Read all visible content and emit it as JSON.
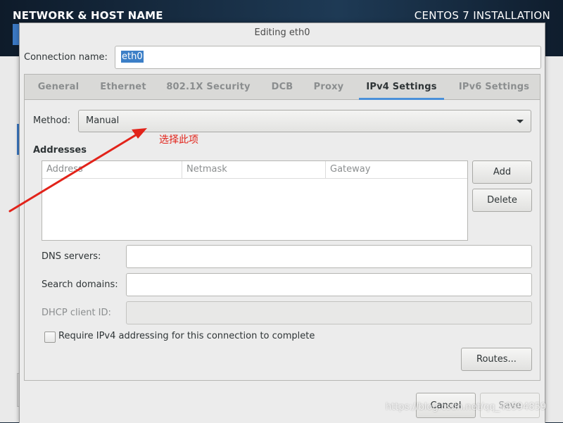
{
  "background": {
    "left_title": "NETWORK & HOST NAME",
    "right_title": "CENTOS 7 INSTALLATION"
  },
  "dialog": {
    "title": "Editing eth0",
    "connection_name_label": "Connection name:",
    "connection_name_value": "eth0",
    "tabs": [
      {
        "label": "General"
      },
      {
        "label": "Ethernet"
      },
      {
        "label": "802.1X Security"
      },
      {
        "label": "DCB"
      },
      {
        "label": "Proxy"
      },
      {
        "label": "IPv4 Settings"
      },
      {
        "label": "IPv6 Settings"
      }
    ],
    "active_tab": "IPv4 Settings",
    "method_label": "Method:",
    "method_value": "Manual",
    "addresses_title": "Addresses",
    "address_columns": [
      "Address",
      "Netmask",
      "Gateway"
    ],
    "add_button": "Add",
    "delete_button": "Delete",
    "dns_label": "DNS servers:",
    "search_label": "Search domains:",
    "dhcp_label": "DHCP client ID:",
    "require_checkbox_label": "Require IPv4 addressing for this connection to complete",
    "routes_button": "Routes...",
    "cancel_button": "Cancel",
    "save_button": "Save"
  },
  "annotation": {
    "text": "选择此项",
    "color": "#e2231a"
  },
  "watermark": "https://blog.csdn.net/qq_42594859",
  "colors": {
    "accent": "#4a90d9",
    "selection": "#3c7fc7"
  }
}
